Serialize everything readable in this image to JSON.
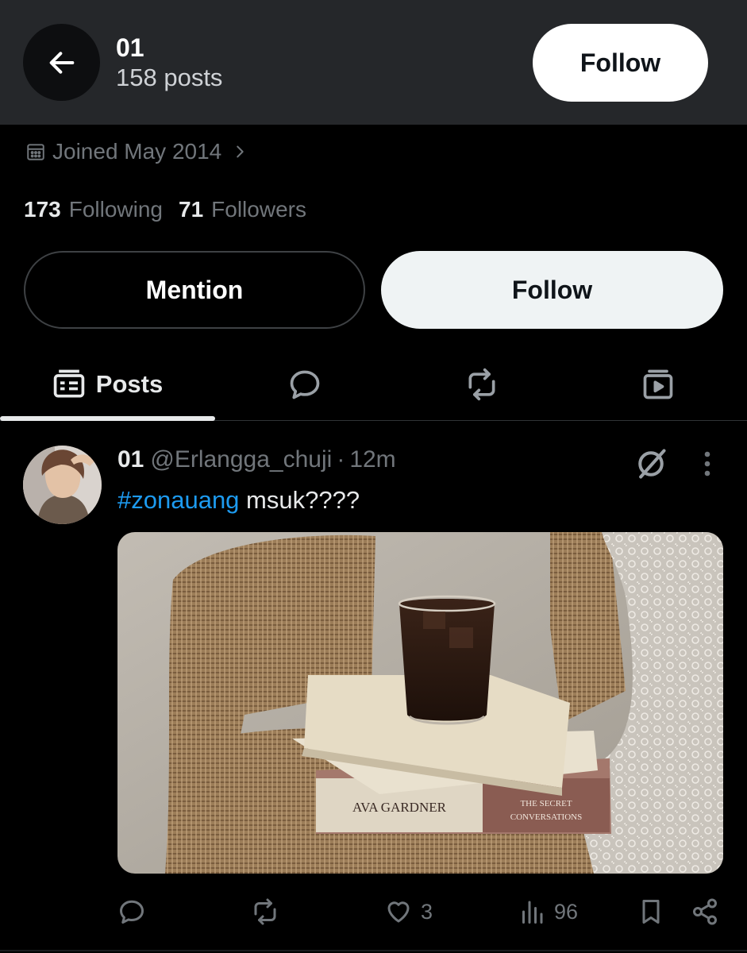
{
  "header": {
    "title": "01",
    "subtitle": "158 posts",
    "follow_label": "Follow"
  },
  "profile": {
    "joined": "Joined May 2014",
    "following_count": "173",
    "following_label": "Following",
    "followers_count": "71",
    "followers_label": "Followers",
    "mention_label": "Mention",
    "follow_label": "Follow"
  },
  "tabs": {
    "posts_label": "Posts",
    "active": "posts"
  },
  "post": {
    "name": "01",
    "handle": "@Erlangga_chuji",
    "separator": "·",
    "time": "12m",
    "hashtag": "#zonauang",
    "text": " msuk????",
    "image": {
      "book_spine_1": "AVA GARDNER",
      "book_spine_2_line1": "THE SECRET",
      "book_spine_2_line2": "CONVERSATIONS"
    },
    "likes": "3",
    "views": "96"
  },
  "colors": {
    "background": "#000000",
    "topbar": "#25272a",
    "text_primary": "#e7e9ea",
    "text_secondary": "#71767b",
    "link": "#1d9bf0"
  }
}
